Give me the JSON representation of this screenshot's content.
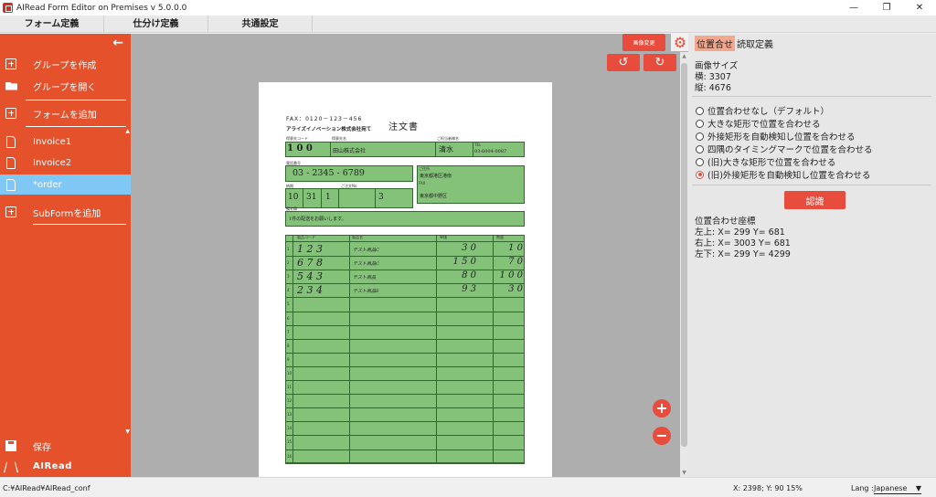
{
  "window": {
    "title": "AIRead Form Editor on Premises v 5.0.0.0",
    "minimize": "—",
    "restore": "❐",
    "close": "✕"
  },
  "menu": [
    "フォーム定義",
    "仕分け定義",
    "共通設定"
  ],
  "sidebar": {
    "back_arrow": "←",
    "create_group": "グループを作成",
    "open_group": "グループを開く",
    "add_form": "フォームを追加",
    "forms": [
      "Invoice1",
      "Invoice2",
      "*order"
    ],
    "selected_form": "*order",
    "add_subform": "SubFormを追加",
    "save": "保存",
    "logo_text": "AIRead"
  },
  "toolbar": {
    "image_change": "画像変更",
    "rotate_left": "↺",
    "rotate_right": "↻",
    "zoom_in": "+",
    "zoom_out": "−"
  },
  "form": {
    "fax": "FAX：0120－123－456",
    "company": "アライズイノベーション株式会社宛て",
    "title": "注文書",
    "labels": {
      "customer_code": "得意先コード",
      "customer_name": "得意先名",
      "person": "ご担当者様名",
      "tel": "TEL",
      "phone": "電話番号",
      "address": "ご住所",
      "delivery_date": "納期",
      "order_no": "ご注文No",
      "fax_label": "FAX",
      "remarks": "備考欄",
      "product_code": "製品コード",
      "product_name": "製品名",
      "unit_price": "単価",
      "qty": "数量"
    },
    "customer_code": "1 0 0",
    "customer_name": "田山株式会社",
    "person": "清水",
    "tel": "03-6004-0087",
    "phone": "03 - 2345 - 6789",
    "address_1": "東京都港区港南",
    "address_2": "東京都中野区",
    "date_month": "10",
    "date_day": "31",
    "date_1": "1",
    "date_3": "3",
    "remarks_text": "1件の配送をお願いします。",
    "rows": [
      {
        "no": "1",
        "code": "1 2 3",
        "name": "テスト商品C",
        "price": "3 0",
        "qty": "1 0"
      },
      {
        "no": "2",
        "code": "6 7 8",
        "name": "テスト商品C",
        "price": "1 5 0",
        "qty": "7 0"
      },
      {
        "no": "3",
        "code": "5 4 3",
        "name": "テスト商品",
        "price": "8 0",
        "qty": "1 0 0"
      },
      {
        "no": "4",
        "code": "2 3 4",
        "name": "テスト商品E",
        "price": "9 3",
        "qty": "3 0"
      }
    ],
    "row_numbers": [
      "5",
      "6",
      "7",
      "8",
      "9",
      "10",
      "11",
      "12",
      "13",
      "14",
      "15",
      "16"
    ]
  },
  "panel": {
    "tabs": [
      "位置合せ",
      "読取定義"
    ],
    "active_tab": "位置合せ",
    "image_size_label": "画像サイズ",
    "width": "横: 3307",
    "height": "縦: 4676",
    "options": [
      "位置合わせなし（デフォルト）",
      "大きな矩形で位置を合わせる",
      "外接矩形を自動検知し位置を合わせる",
      "四隅のタイミングマークで位置を合わせる",
      "(旧)大きな矩形で位置を合わせる",
      "(旧)外接矩形を自動検知し位置を合わせる"
    ],
    "selected_option": 5,
    "recognize_button": "認識",
    "coords_label": "位置合わせ座標",
    "coords": [
      "左上: X= 299   Y= 681",
      "右上: X= 3003   Y= 681",
      "左下: X= 299   Y= 4299"
    ]
  },
  "status": {
    "path": "C:¥AIRead¥AIRead_conf",
    "coords": "X: 2398; Y: 90   15%",
    "lang_label": "Lang :",
    "lang_value": "Japanese"
  },
  "colors": {
    "sidebar_bg": "#e4512b",
    "selected_bg": "#7fc7f4",
    "accent": "#e74c3c",
    "form_green": "#84c27a"
  }
}
